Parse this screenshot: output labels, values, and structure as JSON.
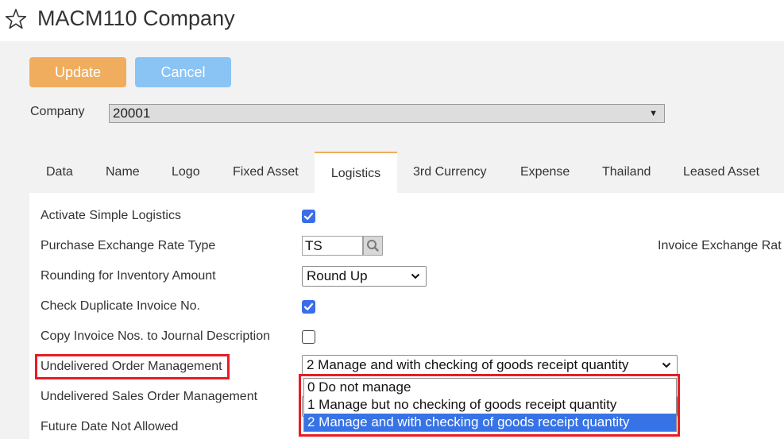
{
  "window": {
    "title": "MACM110 Company"
  },
  "toolbar": {
    "update_label": "Update",
    "cancel_label": "Cancel"
  },
  "company": {
    "label": "Company",
    "value": "20001"
  },
  "tabs": [
    "Data",
    "Name",
    "Logo",
    "Fixed Asset",
    "Logistics",
    "3rd Currency",
    "Expense",
    "Thailand",
    "Leased Asset"
  ],
  "active_tab": "Logistics",
  "fields": {
    "activate_simple_logistics": {
      "label": "Activate Simple Logistics",
      "checked": true
    },
    "purchase_exchange_rate_type": {
      "label": "Purchase Exchange Rate Type",
      "value": "TS"
    },
    "invoice_exchange_rate": {
      "label": "Invoice Exchange Rat"
    },
    "rounding_inventory_amount": {
      "label": "Rounding for Inventory Amount",
      "value": "Round Up"
    },
    "check_duplicate_invoice": {
      "label": "Check Duplicate Invoice No.",
      "checked": true
    },
    "copy_invoice_nos": {
      "label": "Copy Invoice Nos. to Journal Description",
      "checked": false
    },
    "undelivered_order_mgmt": {
      "label": "Undelivered Order Management",
      "value": "2 Manage and with checking of goods receipt quantity"
    },
    "undelivered_sales_order_mgmt": {
      "label": "Undelivered Sales Order Management"
    },
    "future_date_not_allowed": {
      "label": "Future Date Not Allowed"
    }
  },
  "dropdown": {
    "options": [
      "0 Do not manage",
      "1 Manage but no checking of goods receipt quantity",
      "2 Manage and with checking of goods receipt quantity"
    ],
    "selected_index": 2
  },
  "colors": {
    "update": "#f0ad5e",
    "cancel": "#8ac4f5",
    "checkbox": "#3b6ee6",
    "selection": "#3773e6",
    "highlight": "#e81c24"
  },
  "icons": {
    "favorite": "star-icon",
    "search": "search-icon",
    "dropdown": "chevron-down-icon",
    "checkbox": "checkmark-icon"
  }
}
